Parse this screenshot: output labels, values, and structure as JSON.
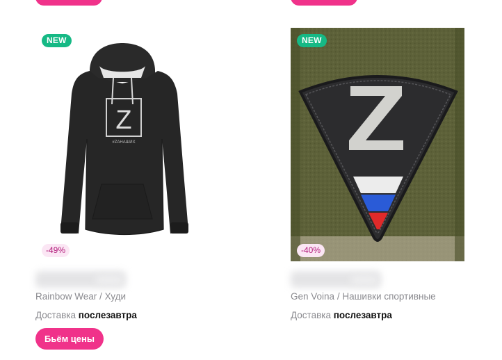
{
  "products": [
    {
      "badge_new": "NEW",
      "discount": "-49%",
      "brand": "Rainbow Wear",
      "separator": " / ",
      "category": "Худи",
      "delivery_label": "Доставка",
      "delivery_value": "послезавтра",
      "image_text": "Z",
      "image_caption": "#ZАНАШИХ",
      "action_label": "Бьём цены"
    },
    {
      "badge_new": "NEW",
      "discount": "-40%",
      "brand": "Gen Voina",
      "separator": " / ",
      "category": "Нашивки спортивные",
      "delivery_label": "Доставка",
      "delivery_value": "послезавтра",
      "image_text": "Z"
    }
  ],
  "colors": {
    "accent": "#f0328a",
    "new_badge": "#16b985",
    "discount_bg": "#fbe6f4",
    "discount_text": "#b01878"
  }
}
